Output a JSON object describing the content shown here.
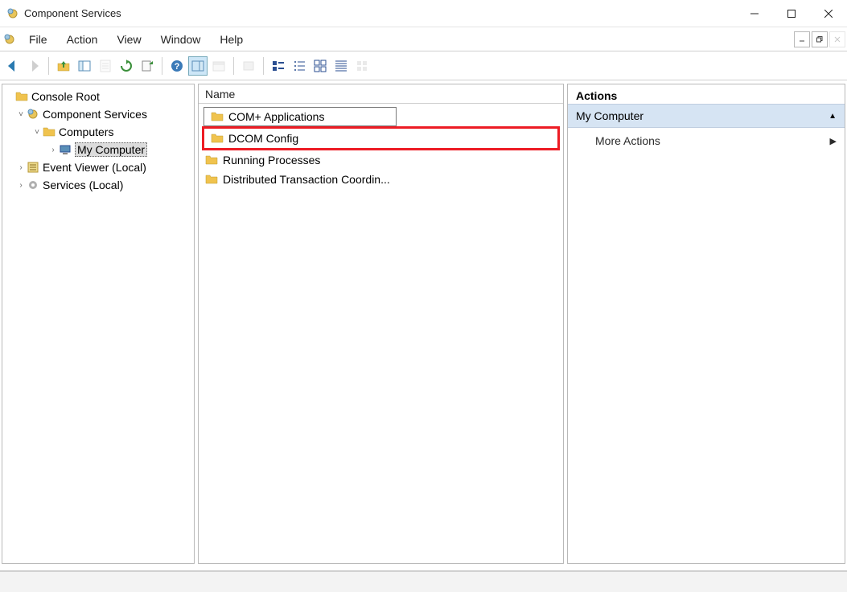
{
  "window": {
    "title": "Component Services"
  },
  "menu": {
    "file": "File",
    "action": "Action",
    "view": "View",
    "window": "Window",
    "help": "Help"
  },
  "tree": {
    "root": "Console Root",
    "component_services": "Component Services",
    "computers": "Computers",
    "my_computer": "My Computer",
    "event_viewer": "Event Viewer (Local)",
    "services": "Services (Local)"
  },
  "list": {
    "header_name": "Name",
    "items": {
      "com_apps": "COM+ Applications",
      "dcom_config": "DCOM Config",
      "running_procs": "Running Processes",
      "dtc": "Distributed Transaction Coordin..."
    }
  },
  "actions": {
    "title": "Actions",
    "section": "My Computer",
    "more": "More Actions"
  }
}
